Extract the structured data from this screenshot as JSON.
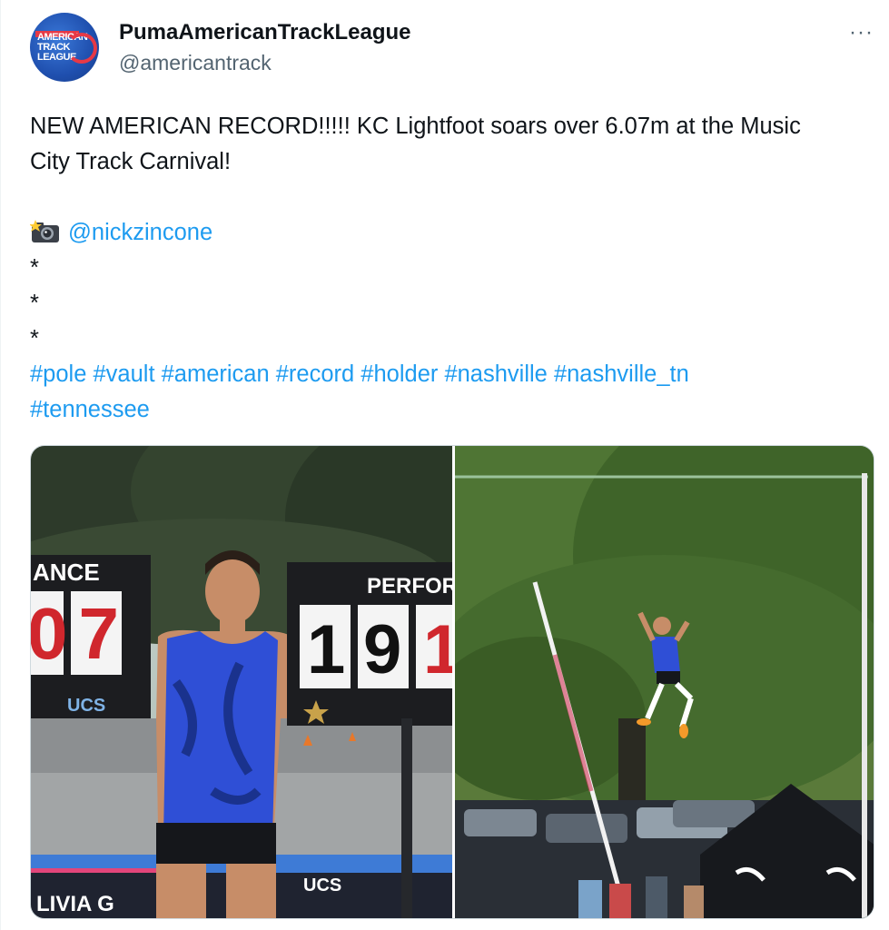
{
  "tweet": {
    "author_name": "PumaAmericanTrackLeague",
    "author_handle": "@americantrack",
    "more_label": "···",
    "avatar_text": [
      "AMERICAN",
      "TRACK",
      "LEAGUE"
    ],
    "body_line1": "NEW AMERICAN RECORD!!!!! KC Lightfoot soars over 6.07m at the Music",
    "body_line2": "City Track Carnival!",
    "camera_icon": "camera-flash-icon",
    "photo_credit": "@nickzincone",
    "star_1": "*",
    "star_2": "*",
    "star_3": "*",
    "hashtags_line1": "#pole #vault #american #record #holder #nashville #nashville_tn",
    "hashtags_line2": "#tennessee"
  },
  "media": {
    "photo1": {
      "board_left_header": "ANCE",
      "board_left_digits": "07",
      "board_left_sponsor": "UCS",
      "board_right_header": "PERFORMA",
      "board_right_digits": [
        "1",
        "9",
        "1"
      ],
      "banner_left": "LIVIA G",
      "banner_right": "UCS"
    },
    "photo2": {}
  },
  "colors": {
    "link": "#1d9bf0",
    "secondary_text": "#536471",
    "primary_text": "#0f1419"
  }
}
